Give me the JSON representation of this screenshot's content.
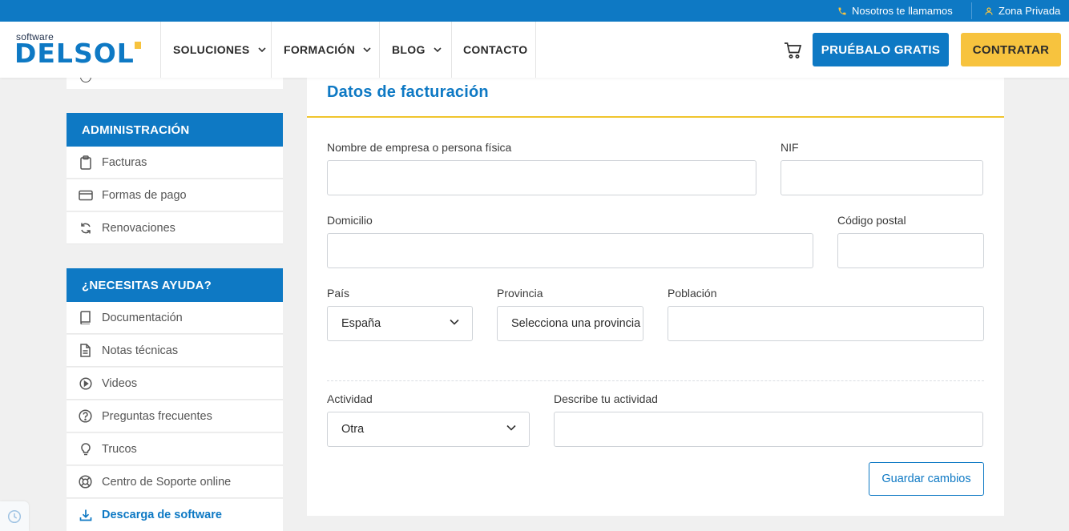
{
  "topbar": {
    "call_label": "Nosotros te llamamos",
    "private_label": "Zona Privada"
  },
  "brand": {
    "small": "software",
    "big": "DELSOL",
    "primary_color": "#0e79c4",
    "accent_color": "#f7c33e"
  },
  "nav": {
    "items": [
      {
        "label": "SOLUCIONES",
        "has_dropdown": true
      },
      {
        "label": "FORMACIÓN",
        "has_dropdown": true
      },
      {
        "label": "BLOG",
        "has_dropdown": true
      },
      {
        "label": "CONTACTO",
        "has_dropdown": false
      }
    ],
    "cart_icon": "cart-icon",
    "try_free_label": "PRUÉBALO GRATIS",
    "buy_label": "CONTRATAR"
  },
  "sidebar": {
    "admin_title": "ADMINISTRACIÓN",
    "admin_items": [
      {
        "label": "Facturas",
        "icon": "clipboard-icon"
      },
      {
        "label": "Formas de pago",
        "icon": "credit-card-icon"
      },
      {
        "label": "Renovaciones",
        "icon": "refresh-icon"
      }
    ],
    "help_title": "¿NECESITAS AYUDA?",
    "help_items": [
      {
        "label": "Documentación",
        "icon": "book-icon"
      },
      {
        "label": "Notas técnicas",
        "icon": "document-icon"
      },
      {
        "label": "Videos",
        "icon": "play-icon"
      },
      {
        "label": "Preguntas frecuentes",
        "icon": "question-icon"
      },
      {
        "label": "Trucos",
        "icon": "lightbulb-icon"
      },
      {
        "label": "Centro de Soporte online",
        "icon": "lifebuoy-icon"
      },
      {
        "label": "Descarga de software",
        "icon": "download-icon",
        "active": true
      }
    ]
  },
  "form": {
    "title": "Datos de facturación",
    "company_label": "Nombre de empresa o persona física",
    "company_value": "",
    "nif_label": "NIF",
    "nif_value": "",
    "address_label": "Domicilio",
    "address_value": "",
    "postal_label": "Código postal",
    "postal_value": "",
    "country_label": "País",
    "country_value": "España",
    "province_label": "Provincia",
    "province_value": "Selecciona una provincia",
    "city_label": "Población",
    "city_value": "",
    "activity_label": "Actividad",
    "activity_value": "Otra",
    "activity_desc_label": "Describe tu actividad",
    "activity_desc_value": "",
    "save_label": "Guardar cambios"
  }
}
